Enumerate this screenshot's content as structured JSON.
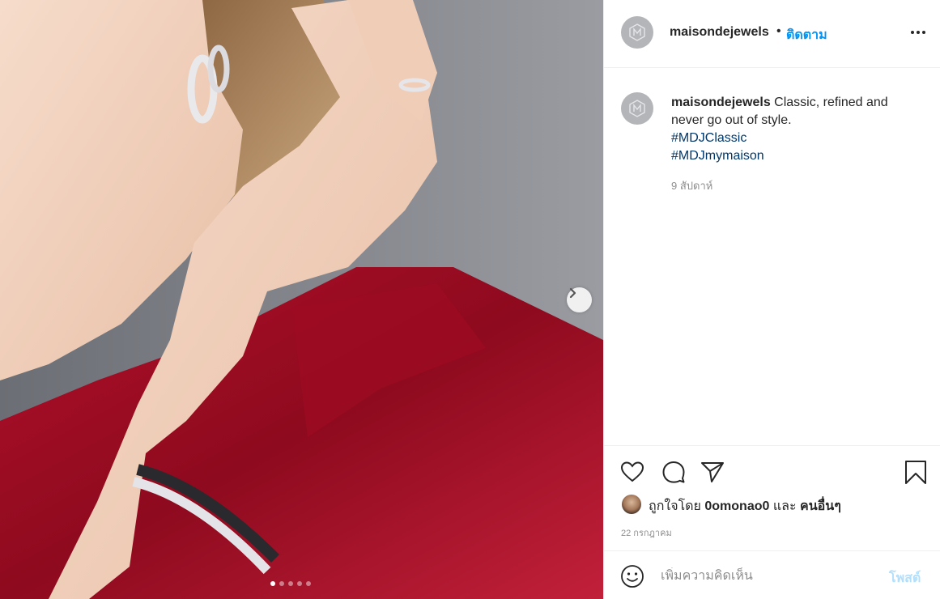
{
  "photo": {
    "alt_subject": "jewelry-model-photo",
    "carousel_dots": 5,
    "active_dot": 0
  },
  "header": {
    "username": "maisondejewels",
    "separator": "•",
    "follow_label": "ติดตาม"
  },
  "caption": {
    "username": "maisondejewels",
    "text": "Classic, refined and never go out of style.",
    "hashtags": [
      "#MDJClassic",
      "#MDJmymaison"
    ],
    "time": "9 สัปดาห์"
  },
  "likes": {
    "prefix": "ถูกใจโดย",
    "user": "0omonao0",
    "conjunction": "และ",
    "others": "คนอื่นๆ"
  },
  "post_date": "22 กรกฎาคม",
  "comment": {
    "placeholder": "เพิ่มความคิดเห็น",
    "post_label": "โพสต์"
  },
  "icons": {
    "like": "heart-icon",
    "comment": "comment-icon",
    "share": "paper-plane-icon",
    "save": "bookmark-icon",
    "more": "more-options-icon",
    "emoji": "emoji-icon",
    "next": "chevron-right-icon"
  },
  "colors": {
    "link_blue": "#0095f6",
    "hashtag_blue": "#00376b",
    "muted": "#8e8e8e",
    "post_disabled": "#b2dffc"
  }
}
